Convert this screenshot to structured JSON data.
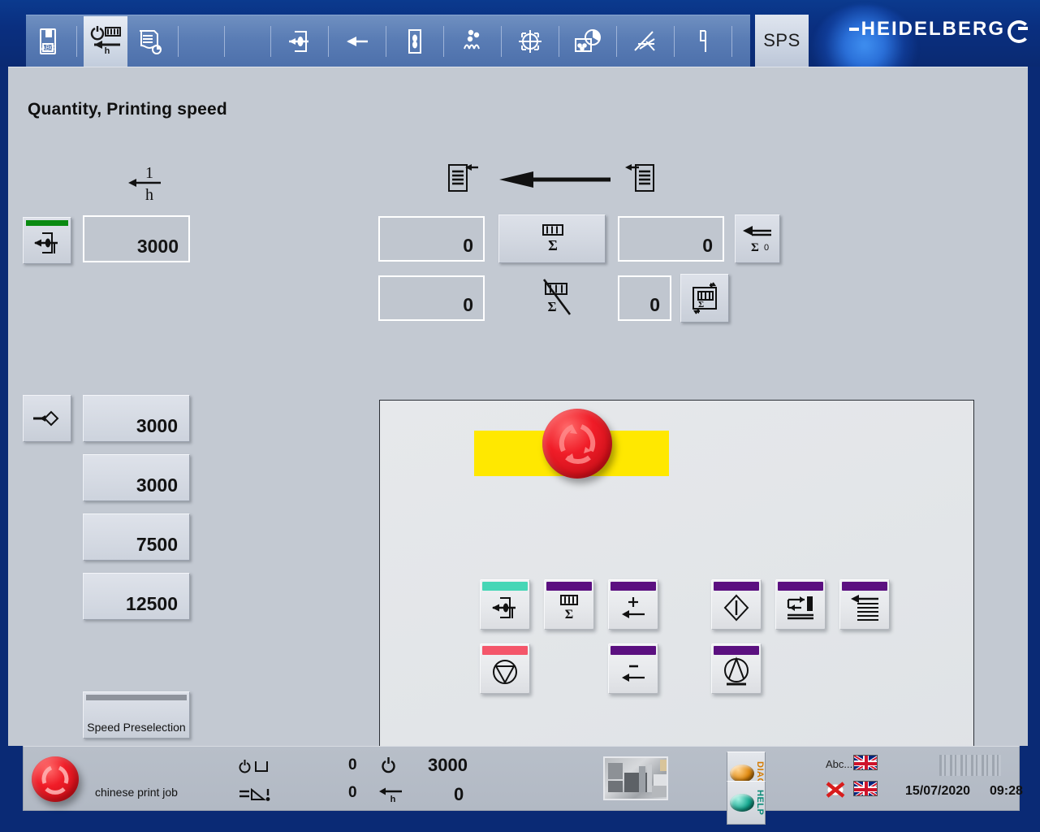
{
  "header": {
    "logo_text": "HEIDELBERG",
    "sps_label": "SPS",
    "toolbar_items": [
      {
        "name": "job-data-icon",
        "title": "Job data"
      },
      {
        "name": "quantity-printing-speed-icon",
        "title": "Quantity, Printing speed"
      },
      {
        "name": "paper-roll-icon",
        "title": "Substrate"
      },
      {
        "name": "feeder-icon",
        "title": "Feeder"
      },
      {
        "name": "sheet-travel-icon",
        "title": "Sheet travel"
      },
      {
        "name": "register-icon",
        "title": "Register"
      },
      {
        "name": "powder-spray-icon",
        "title": "Powder"
      },
      {
        "name": "crosshair-target-icon",
        "title": "Target"
      },
      {
        "name": "ink-density-icon",
        "title": "Ink control"
      },
      {
        "name": "washup-icon",
        "title": "Wash-up"
      },
      {
        "name": "step-signal-icon",
        "title": "Signal"
      }
    ]
  },
  "page": {
    "title": "Quantity, Printing speed"
  },
  "left_panel": {
    "speed_unit_label_num": "1",
    "speed_unit_label_den": "h",
    "target_speed_button_icon": "feeder-speed-icon",
    "target_speed_value": "3000",
    "preset_icon_button": "speed-transfer-icon",
    "preset_values": [
      "3000",
      "3000",
      "7500",
      "12500"
    ],
    "speed_preselection_label": "Speed Preselection"
  },
  "counters": {
    "sheet_in_icon": "sheets-entering-icon",
    "arrow_icon": "left-arrow-icon",
    "sheet_out_icon": "sheets-leaving-icon",
    "good_copies_value": "0",
    "total_counter_button_icon": "total-counter-icon",
    "total_counter_value": "0",
    "reset_counter_button_icon": "counter-reset-icon",
    "reset_counter_badge": "0",
    "waste_value": "0",
    "waste_icon": "waste-counter-icon",
    "waste_total_value": "0",
    "counter_cycle_button_icon": "counter-cycle-icon"
  },
  "work_panel": {
    "estop_icon": "machine-run-stop-button",
    "row1": [
      {
        "name": "feeder-start-button",
        "icon": "feeder-icon",
        "cap_color": "#46d6b6"
      },
      {
        "name": "counter-button",
        "icon": "total-counter-icon",
        "cap_color": "#5b1080"
      },
      {
        "name": "speed-increase-button",
        "icon": "plus-arrow-icon",
        "cap_color": "#5b1080"
      },
      {
        "name": "print-on-button",
        "icon": "diamond-line-icon",
        "cap_color": "#5b1080"
      },
      {
        "name": "cycle-repeat-button",
        "icon": "repeat-cycle-icon",
        "cap_color": "#5b1080"
      },
      {
        "name": "delivery-button",
        "icon": "delivery-stack-icon",
        "cap_color": "#5b1080"
      }
    ],
    "row2": [
      {
        "name": "machine-stop-button",
        "icon": "stop-triangle-icon",
        "cap_color": "#f4566a"
      },
      {
        "name": "speed-decrease-button",
        "icon": "minus-arrow-icon",
        "cap_color": "#5b1080"
      },
      {
        "name": "impression-off-button",
        "icon": "impression-circle-icon",
        "cap_color": "#5b1080"
      }
    ]
  },
  "status_bar": {
    "job_name": "chinese print job",
    "metric1_icon": "run-time-icon",
    "metric1_value": "0",
    "metric2_icon": "makeready-icon",
    "metric2_value": "0",
    "metric3_icon": "power-icon",
    "metric3_value": "3000",
    "metric4_icon": "speed-per-hour-icon",
    "metric4_value": "0",
    "machine_thumbnail": "press-thumbnail",
    "diag_label": "DIAG",
    "help_label": "HELP",
    "abc_label": "Abc...",
    "flag1": "uk-flag-icon",
    "flag2": "uk-flag-icon",
    "no_entry_icon": "crossed-out-icon",
    "date": "15/07/2020",
    "time": "09:28"
  },
  "colors": {
    "accent_purple": "#5b1080",
    "accent_teal": "#46d6b6",
    "accent_red": "#f4566a",
    "green_cap": "#0a8a12",
    "yellow_band": "#ffe800",
    "header_blue": "#0a2f80"
  }
}
